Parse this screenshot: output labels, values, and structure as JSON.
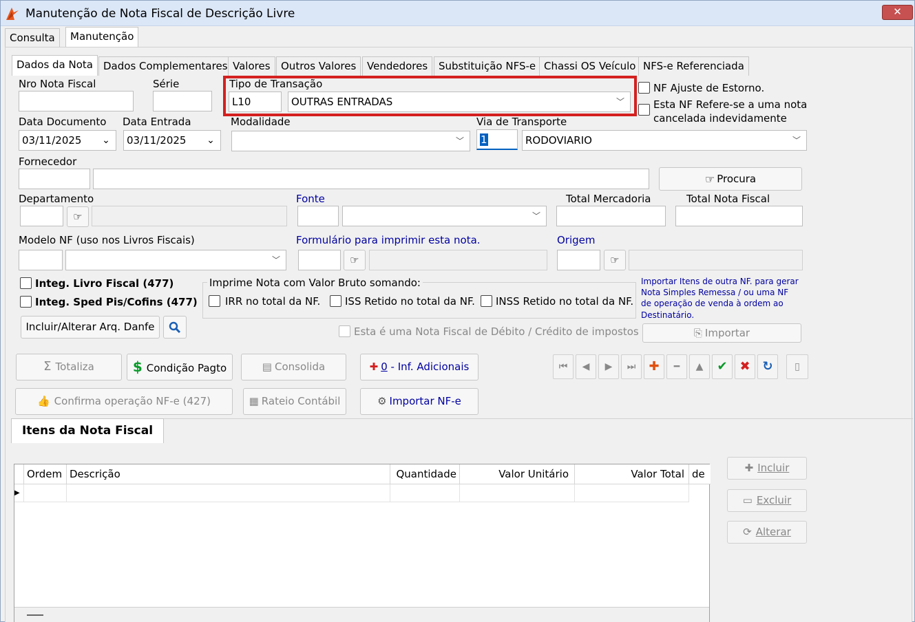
{
  "window": {
    "title": "Manutenção de Nota Fiscal de Descrição Livre",
    "close": "✕"
  },
  "top_tabs": [
    "Consulta",
    "Manutenção"
  ],
  "sub_tabs": [
    "Dados da Nota",
    "Dados Complementares",
    "Valores",
    "Outros Valores",
    "Vendedores",
    "Substituição NFS-e",
    "Chassi OS Veículo",
    "NFS-e Referenciada"
  ],
  "form": {
    "nro_nota_label": "Nro Nota Fiscal",
    "serie_label": "Série",
    "tipo_transacao_label": "Tipo de Transação",
    "tipo_transacao_code": "L10",
    "tipo_transacao_value": "OUTRAS ENTRADAS",
    "nf_ajuste_label": "NF Ajuste de Estorno.",
    "nf_refere_label_1": "Esta NF Refere-se a uma nota",
    "nf_refere_label_2": "cancelada indevidamente",
    "data_documento_label": "Data Documento",
    "data_documento_value": "03/11/2025",
    "data_entrada_label": "Data Entrada",
    "data_entrada_value": "03/11/2025",
    "modalidade_label": "Modalidade",
    "via_transporte_label": "Via de Transporte",
    "via_transporte_code": "1",
    "via_transporte_value": "RODOVIARIO",
    "fornecedor_label": "Fornecedor",
    "procura_label": "Procura",
    "departamento_label": "Departamento",
    "fonte_label": "Fonte",
    "total_mercadoria_label": "Total Mercadoria",
    "total_nota_label": "Total Nota Fiscal",
    "modelo_nf_label": "Modelo NF (uso nos Livros Fiscais)",
    "formulario_label": "Formulário para imprimir esta nota.",
    "origem_label": "Origem",
    "integ_livro_label": "Integ. Livro Fiscal (477)",
    "integ_sped_label": "Integ. Sped Pis/Cofins (477)",
    "imprime_group_label": "Imprime Nota com Valor Bruto somando:",
    "irr_label": "IRR no total da NF.",
    "iss_label": "ISS Retido no total da NF.",
    "inss_label": "INSS Retido no total da NF.",
    "importar_info_1": "Importar Itens de outra NF. para gerar",
    "importar_info_2": "Nota Simples Remessa / ou uma NF",
    "importar_info_3": "de operação de venda à ordem ao",
    "importar_info_4": "Destinatário.",
    "incluir_danfe_label": "Incluir/Alterar Arq. Danfe",
    "nota_debito_label": "Esta é uma Nota Fiscal de Débito / Crédito de impostos",
    "importar_label": "Importar"
  },
  "actions": {
    "totaliza": "Totaliza",
    "condicao_pagto": "Condição Pagto",
    "consolida": "Consolida",
    "inf_adicionais_count": "0",
    "inf_adicionais": " - Inf. Adicionais",
    "confirma_operacao": "Confirma operação NF-e (427)",
    "rateio_contabil": "Rateio Contábil",
    "importar_nfe": "Importar NF-e"
  },
  "items": {
    "tab_label": "Itens da Nota Fiscal",
    "columns": [
      "Ordem",
      "Descrição",
      "Quantidade",
      "Valor Unitário",
      "Valor Total",
      "de"
    ],
    "incluir": "Incluir",
    "excluir": "Excluir",
    "alterar": "Alterar"
  },
  "colors": {
    "accent_blue": "#0000a0",
    "highlight_red": "#d42020",
    "green": "#0a9a2a"
  }
}
